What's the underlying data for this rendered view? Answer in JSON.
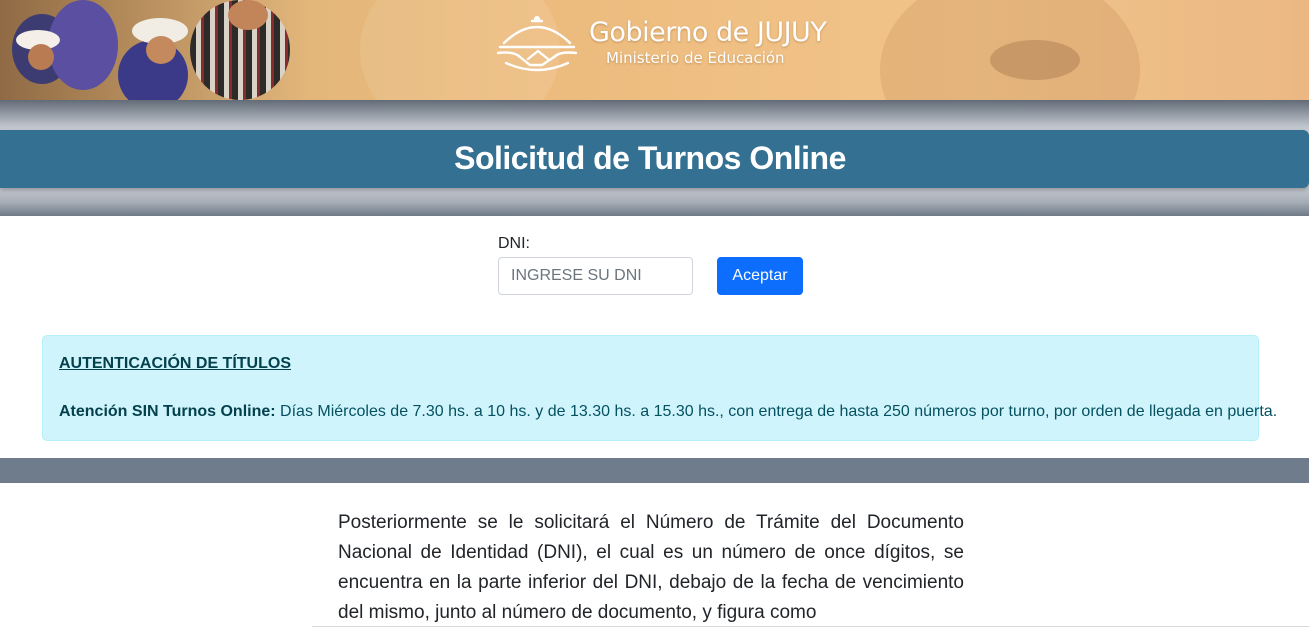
{
  "header": {
    "brand_title": "Gobierno de JUJUY",
    "brand_subtitle": "Ministerio de Educación"
  },
  "page_title": "Solicitud de Turnos Online",
  "form": {
    "dni_label": "DNI:",
    "dni_placeholder": "INGRESE SU DNI",
    "dni_value": "",
    "submit_label": "Aceptar"
  },
  "notice": {
    "heading": "AUTENTICACIÓN DE TÍTULOS",
    "lead": "Atención SIN Turnos Online:",
    "text": " Días Miércoles de 7.30 hs. a 10 hs. y de 13.30 hs. a 15.30 hs., con entrega de hasta 250 números por turno, por orden de llegada en puerta."
  },
  "instructions": {
    "paragraph": "Posteriormente se le solicitará el Número de Trámite del Documento Nacional de Identidad (DNI), el cual es un número de once dígitos, se encuentra en la parte inferior del DNI, debajo de la fecha de vencimiento del mismo, junto al número de documento, y figura como"
  },
  "colors": {
    "title_bar": "#337091",
    "button": "#0d6efd",
    "alert_bg": "#cff4fc",
    "alert_text": "#055160",
    "divider": "#6f7c8c"
  },
  "icons": {
    "logo": "handshake-dome-logo-icon"
  }
}
